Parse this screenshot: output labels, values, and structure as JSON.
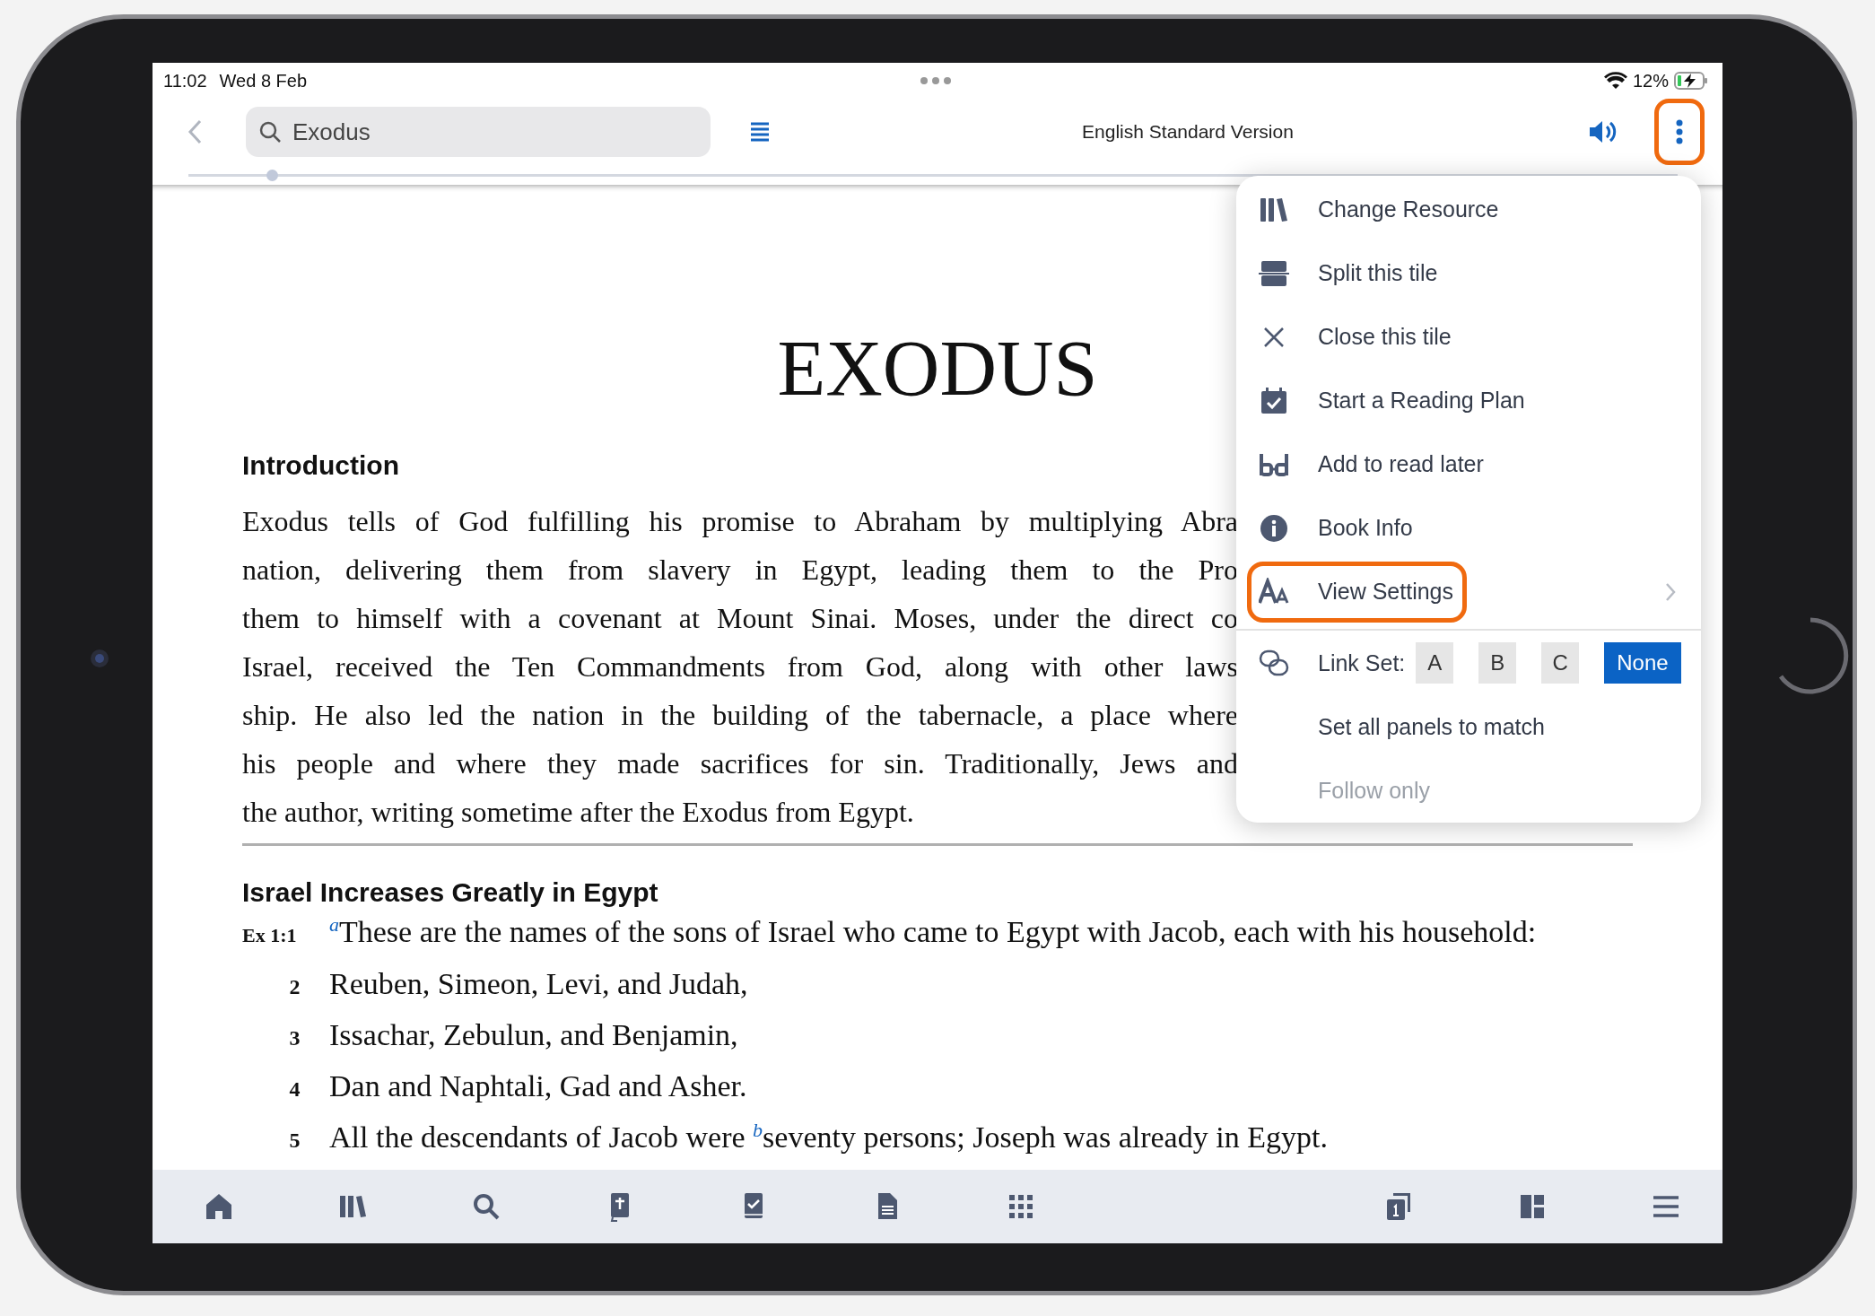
{
  "status_bar": {
    "time": "11:02",
    "date": "Wed 8 Feb",
    "battery": "12%"
  },
  "toolbar": {
    "search": {
      "value": "Exodus"
    },
    "title": "English Standard Version",
    "more_highlighted": true
  },
  "reading_progress": {
    "level": 0.056
  },
  "document": {
    "title": "EXODUS",
    "intro_heading": "Introduction",
    "intro_lines": [
      "Exodus tells of God fulfilling his promise to Abraham by multiplying Abra",
      "nation, delivering them from slavery in Egypt, leading them to the Pro",
      "them to himself with a covenant at Mount Sinai. Moses, under the direct co",
      "Israel, received the Ten Commandments from God, along with other laws",
      "ship. He also led the nation in the building of the tabernacle, a place where",
      "his people and where they made sacrifices for sin. Traditionally, Jews and",
      "the author, writing sometime after the Exodus from Egypt."
    ],
    "section_heading": "Israel Increases Greatly in Egypt",
    "verses": [
      {
        "number": "Ex 1:1",
        "text": "$^{a}$These are the names of the sons of Israel who came to Egypt with Jacob, each with his household:"
      },
      {
        "number": "2",
        "text": "Reuben, Simeon, Levi, and Judah,"
      },
      {
        "number": "3",
        "text": "Issachar, Zebulun, and Benjamin,"
      },
      {
        "number": "4",
        "text": "Dan and Naphtali, Gad and Asher."
      },
      {
        "number": "5",
        "text": "All the descendants of Jacob were $^{b}$seventy persons; Joseph was already in Egypt."
      }
    ]
  },
  "menu": {
    "items": [
      {
        "label": "Change Resource",
        "highlighted": false,
        "submenu": false
      },
      {
        "label": "Split this tile",
        "highlighted": false,
        "submenu": false
      },
      {
        "label": "Close this tile",
        "highlighted": false,
        "submenu": false
      },
      {
        "label": "Start a Reading Plan",
        "highlighted": false,
        "submenu": false
      },
      {
        "label": "Add to read later",
        "highlighted": false,
        "submenu": false
      },
      {
        "label": "Book Info",
        "highlighted": false,
        "submenu": false
      },
      {
        "label": "View Settings",
        "highlighted": true,
        "submenu": true
      }
    ],
    "link_set": {
      "label": "Link Set:",
      "options": [
        {
          "label": "A",
          "selected": false
        },
        {
          "label": "B",
          "selected": false
        },
        {
          "label": "C",
          "selected": false
        },
        {
          "label": "None",
          "selected": true
        }
      ]
    },
    "sub_items": [
      {
        "label": "Set all panels to match",
        "disabled": false
      },
      {
        "label": "Follow only",
        "disabled": true
      }
    ]
  }
}
